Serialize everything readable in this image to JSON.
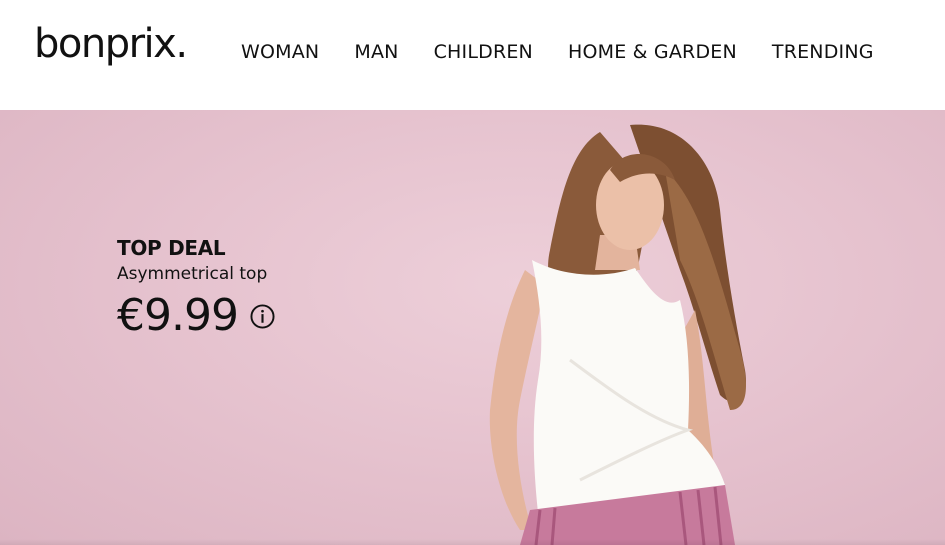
{
  "header": {
    "logo": "bonprix.",
    "nav": [
      {
        "label": "WOMAN"
      },
      {
        "label": "MAN"
      },
      {
        "label": "CHILDREN"
      },
      {
        "label": "HOME & GARDEN"
      },
      {
        "label": "TRENDING"
      }
    ]
  },
  "hero": {
    "label": "TOP DEAL",
    "product": "Asymmetrical top",
    "price": "€9.99",
    "icons": {
      "info": "info-icon"
    },
    "colors": {
      "background": "#e6c3cf"
    }
  }
}
